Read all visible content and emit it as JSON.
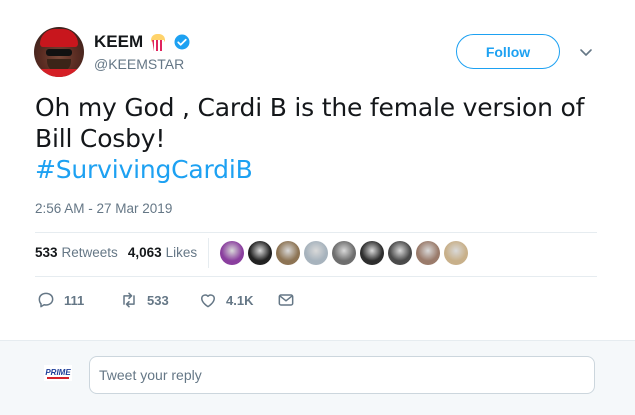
{
  "author": {
    "display_name": "KEEM",
    "handle": "@KEEMSTAR",
    "emoji_icon": "popcorn-icon",
    "verified_icon": "verified-badge-icon"
  },
  "follow_label": "Follow",
  "tweet": {
    "text_line1": "Oh my God , Cardi B is the female version of",
    "text_line2": "Bill Cosby!",
    "hashtag": "#SurvivingCardiB",
    "timestamp": "2:56 AM - 27 Mar 2019"
  },
  "stats": {
    "retweets_count": "533",
    "retweets_label": "Retweets",
    "likes_count": "4,063",
    "likes_label": "Likes"
  },
  "likers": [
    {
      "color": "#8a3f9e"
    },
    {
      "color": "#222222"
    },
    {
      "color": "#8d7454"
    },
    {
      "color": "#a7b3bd"
    },
    {
      "color": "#6e6e6e"
    },
    {
      "color": "#2e2e2e"
    },
    {
      "color": "#4a4a4a"
    },
    {
      "color": "#9a7b6b"
    },
    {
      "color": "#c8b08a"
    }
  ],
  "actions": {
    "reply_count": "111",
    "retweet_count": "533",
    "like_count": "4.1K"
  },
  "reply": {
    "placeholder": "Tweet your reply",
    "logo_text": "PRIME"
  },
  "colors": {
    "accent": "#1da1f2",
    "secondary_text": "#657786"
  }
}
